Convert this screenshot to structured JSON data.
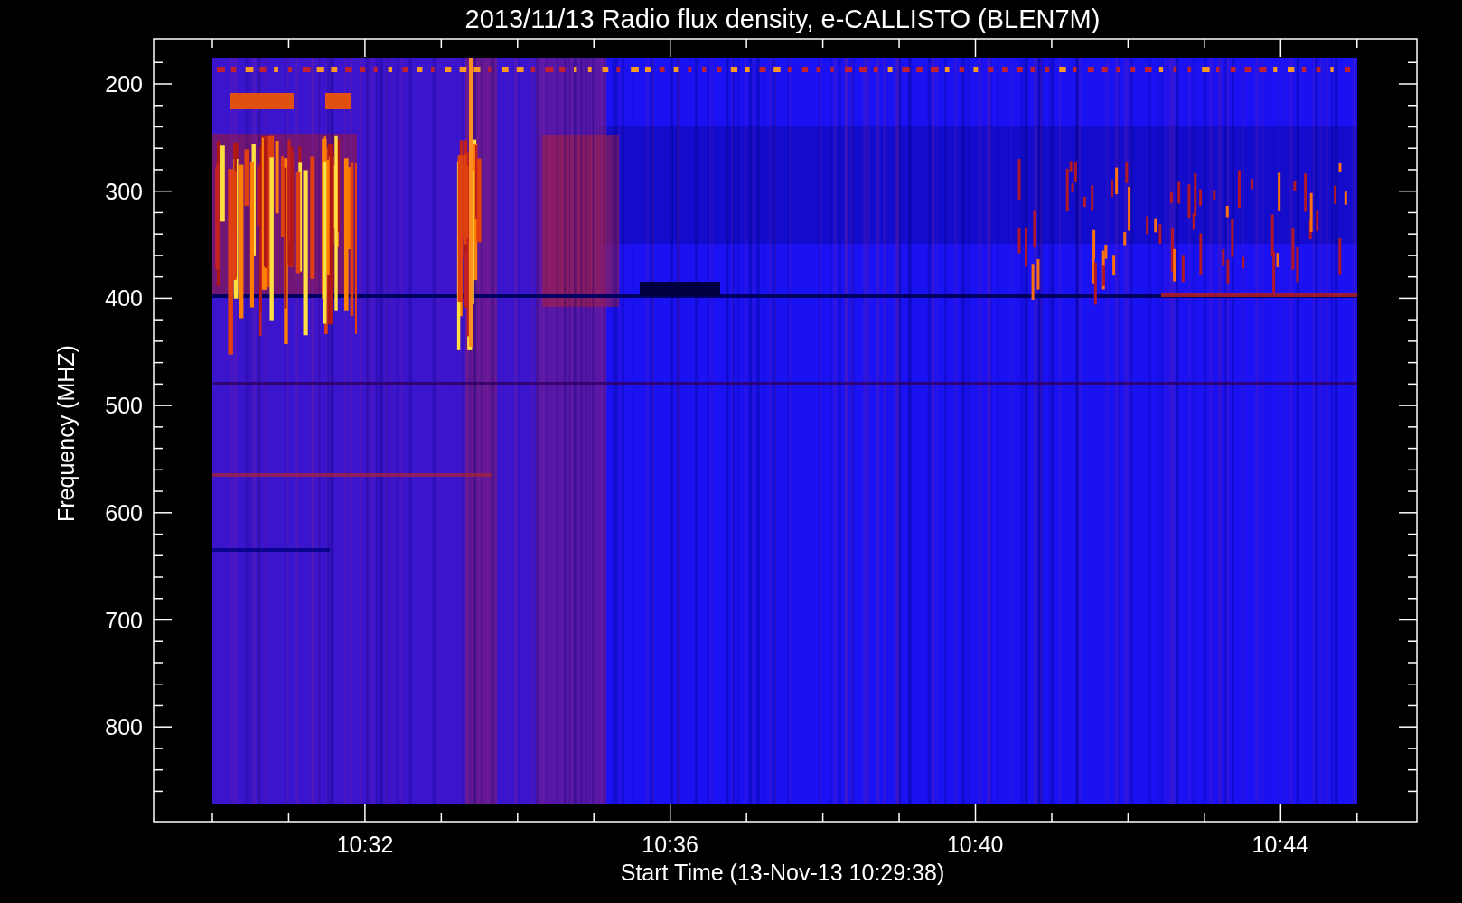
{
  "title": "2013/11/13  Radio flux density, e-CALLISTO (BLEN7M)",
  "y_axis": {
    "label": "Frequency (MHZ)",
    "ticks": [
      "200",
      "300",
      "400",
      "500",
      "600",
      "700",
      "800"
    ]
  },
  "x_axis": {
    "label": "Start Time (13-Nov-13 10:29:38)",
    "ticks": [
      "10:32",
      "10:36",
      "10:40",
      "10:44"
    ]
  }
}
